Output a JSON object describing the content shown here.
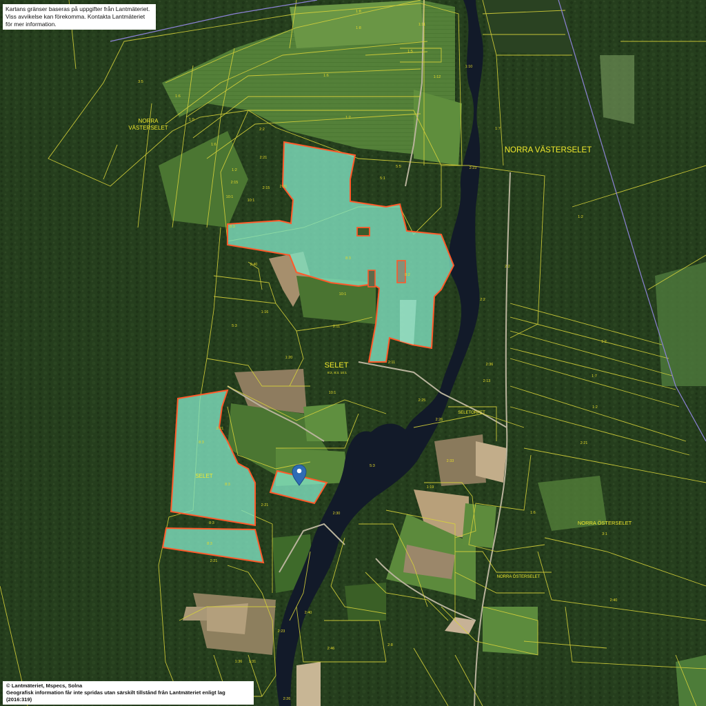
{
  "notices": {
    "top_line1": "Kartans gränser baseras på uppgifter från Lantmäteriet.",
    "top_line2": "Viss avvikelse kan förekomma. Kontakta Lantmäteriet för mer information.",
    "bottom_line1": "© Lantmäteriet, Mspecs, Solna",
    "bottom_line2": "Geografisk information får inte spridas utan särskilt tillstånd från Lantmäteriet enligt lag (2016:319)"
  },
  "place_labels": {
    "norra_vasterselet_west_1": "NORRA",
    "norra_vasterselet_west_2": "VÄSTERSELET",
    "norra_vasterselet_east": "NORRA VÄSTERSELET",
    "selet_center": "SELET",
    "selet_center_sub": "8:2, 8:3, 10:1",
    "selet_parcel": "SELET",
    "seletorpet": "SELETORPET",
    "norra_osterselet_east": "NORRA ÖSTERSELET",
    "norra_osterselet_center": "NORRA ÖSTERSELET"
  },
  "parcel_labels": {
    "p01": "1:8",
    "p02": "1:11",
    "p03": "1:10",
    "p04": "1:8",
    "p05": "1:5",
    "p06": "1:12",
    "p07": "1:6",
    "p08": "3:5",
    "p09": "1:6",
    "p10": "1:9",
    "p11": "1:6",
    "p12": "2:2",
    "p13": "1:2",
    "p14": "2:21",
    "p15": "1:2",
    "p16": "2:15",
    "p17": "2:15",
    "p18": "2:21",
    "p19": "10:1",
    "p20": "10:1",
    "p21": "8:3",
    "p22": "5:5",
    "p23": "5:1",
    "p24": "2:23",
    "p25": "1:7",
    "p26": "1:2",
    "p27": "2:40",
    "p28": "8:3",
    "p29": "8:2",
    "p30": "10:1",
    "p31": "1:16",
    "p32": "5:3",
    "p33": "2:2",
    "p34": "2:2",
    "p35": "2:11",
    "p36": "2:11",
    "p37": "2:36",
    "p38": "2:13",
    "p39": "1:20",
    "p40": "10:1",
    "p41": "2:25",
    "p42": "2:26",
    "p43": "8:3",
    "p44": "8:3",
    "p45": "8:3",
    "p46": "8:3",
    "p47": "2:21",
    "p48": "2:21",
    "p49": "5:3",
    "p50": "2:30",
    "p51": "1:19",
    "p52": "2:33",
    "p53": "2:40",
    "p54": "2:21",
    "p55": "1:6",
    "p56": "2:21",
    "p57": "3:1",
    "p58": "2:40",
    "p59": "1:2",
    "p60": "1:7",
    "p61": "1:2",
    "p62": "2:46",
    "p63": "1:36",
    "p64": "1:31",
    "p65": "2:23",
    "p66": "2:26",
    "p67": "2:8"
  },
  "colors": {
    "forest": "#27401f",
    "field": "#4f7a34",
    "water": "#141c2c",
    "boundary": "#d8d33a",
    "municipal_boundary": "#8d83d8",
    "highlight_fill": "#7fe0bf",
    "highlight_stroke": "#ff5a2a",
    "pin": "#2f6db5"
  },
  "icons": {
    "location_pin": "location-pin-icon"
  }
}
